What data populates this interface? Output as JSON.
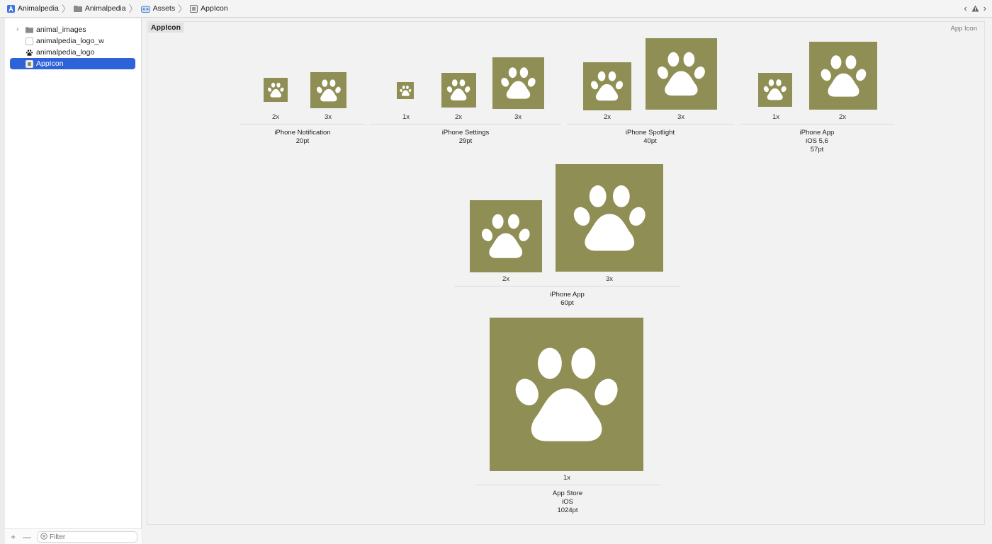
{
  "breadcrumb": [
    {
      "label": "Animalpedia",
      "icon": "xcode-project-icon"
    },
    {
      "label": "Animalpedia",
      "icon": "folder-icon"
    },
    {
      "label": "Assets",
      "icon": "asset-catalog-icon"
    },
    {
      "label": "AppIcon",
      "icon": "appicon-set-icon"
    }
  ],
  "sidebar": {
    "items": [
      {
        "label": "animal_images",
        "icon": "folder-icon",
        "disclosure": "›"
      },
      {
        "label": "animalpedia_logo_w",
        "icon": "image-set-blank-icon"
      },
      {
        "label": "animalpedia_logo",
        "icon": "paw-image-set-icon"
      },
      {
        "label": "AppIcon",
        "icon": "appicon-set-icon",
        "selected": true
      }
    ],
    "add_label": "+",
    "remove_label": "—",
    "filter_placeholder": "Filter"
  },
  "main": {
    "set_title": "AppIcon",
    "set_kind": "App Icon",
    "icon_color": "#8f8f55",
    "groups": [
      {
        "name": "iPhone Notification",
        "size": "20pt",
        "scales": [
          "2x",
          "3x"
        ]
      },
      {
        "name": "iPhone Settings",
        "size": "29pt",
        "scales": [
          "1x",
          "2x",
          "3x"
        ]
      },
      {
        "name": "iPhone Spotlight",
        "size": "40pt",
        "scales": [
          "2x",
          "3x"
        ]
      },
      {
        "name": "iPhone App",
        "sub": "iOS 5,6",
        "size": "57pt",
        "scales": [
          "1x",
          "2x"
        ]
      },
      {
        "name": "iPhone App",
        "size": "60pt",
        "scales": [
          "2x",
          "3x"
        ]
      },
      {
        "name": "App Store",
        "sub": "iOS",
        "size": "1024pt",
        "scales": [
          "1x"
        ]
      }
    ]
  }
}
